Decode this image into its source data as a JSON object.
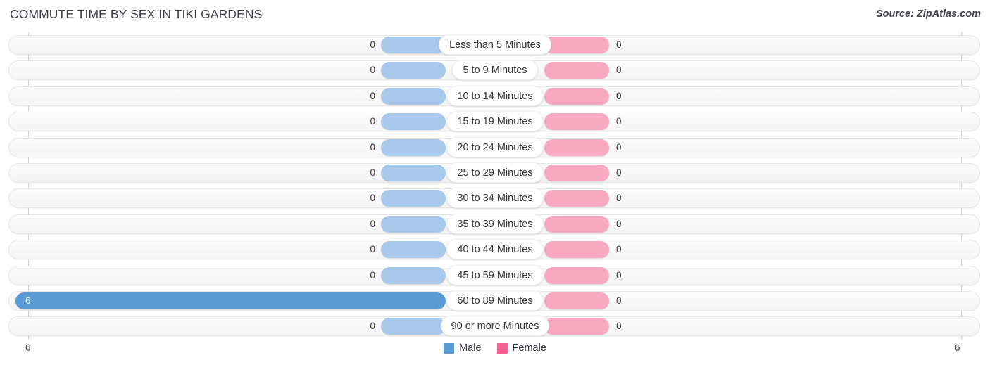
{
  "header": {
    "title": "COMMUTE TIME BY SEX IN TIKI GARDENS",
    "source": "Source: ZipAtlas.com"
  },
  "axis": {
    "left_label": "6",
    "right_label": "6"
  },
  "legend": {
    "items": [
      {
        "label": "Male",
        "color": "#5b9bd5",
        "icon": "square-swatch-icon"
      },
      {
        "label": "Female",
        "color": "#f2608f",
        "icon": "square-swatch-icon"
      }
    ]
  },
  "colors": {
    "male_bar": "#a8c8ec",
    "male_bar_highlight": "#5b9bd5",
    "female_bar": "#f9a8c2",
    "track": "#f6f6f6",
    "title_text": "#3b3b44"
  },
  "chart_data": {
    "type": "bar",
    "title": "COMMUTE TIME BY SEX IN TIKI GARDENS",
    "subtitle": "",
    "xlabel": "",
    "ylabel": "",
    "orientation": "horizontal",
    "style": "diverging-bidirectional",
    "grid": true,
    "legend_position": "bottom-center",
    "xlim": [
      6,
      6
    ],
    "axis_min_left": 6,
    "axis_min_right": 6,
    "categories": [
      "Less than 5 Minutes",
      "5 to 9 Minutes",
      "10 to 14 Minutes",
      "15 to 19 Minutes",
      "20 to 24 Minutes",
      "25 to 29 Minutes",
      "30 to 34 Minutes",
      "35 to 39 Minutes",
      "40 to 44 Minutes",
      "45 to 59 Minutes",
      "60 to 89 Minutes",
      "90 or more Minutes"
    ],
    "series": [
      {
        "name": "Male",
        "color": "#5b9bd5",
        "side": "left",
        "values": [
          0,
          0,
          0,
          0,
          0,
          0,
          0,
          0,
          0,
          0,
          6,
          0
        ]
      },
      {
        "name": "Female",
        "color": "#f2608f",
        "side": "right",
        "values": [
          0,
          0,
          0,
          0,
          0,
          0,
          0,
          0,
          0,
          0,
          0,
          0
        ]
      }
    ]
  },
  "rows": [
    {
      "label": "Less than 5 Minutes",
      "male": "0",
      "female": "0",
      "male_pct": 0,
      "female_pct": 0,
      "male_inside": false
    },
    {
      "label": "5 to 9 Minutes",
      "male": "0",
      "female": "0",
      "male_pct": 0,
      "female_pct": 0,
      "male_inside": false
    },
    {
      "label": "10 to 14 Minutes",
      "male": "0",
      "female": "0",
      "male_pct": 0,
      "female_pct": 0,
      "male_inside": false
    },
    {
      "label": "15 to 19 Minutes",
      "male": "0",
      "female": "0",
      "male_pct": 0,
      "female_pct": 0,
      "male_inside": false
    },
    {
      "label": "20 to 24 Minutes",
      "male": "0",
      "female": "0",
      "male_pct": 0,
      "female_pct": 0,
      "male_inside": false
    },
    {
      "label": "25 to 29 Minutes",
      "male": "0",
      "female": "0",
      "male_pct": 0,
      "female_pct": 0,
      "male_inside": false
    },
    {
      "label": "30 to 34 Minutes",
      "male": "0",
      "female": "0",
      "male_pct": 0,
      "female_pct": 0,
      "male_inside": false
    },
    {
      "label": "35 to 39 Minutes",
      "male": "0",
      "female": "0",
      "male_pct": 0,
      "female_pct": 0,
      "male_inside": false
    },
    {
      "label": "40 to 44 Minutes",
      "male": "0",
      "female": "0",
      "male_pct": 0,
      "female_pct": 0,
      "male_inside": false
    },
    {
      "label": "45 to 59 Minutes",
      "male": "0",
      "female": "0",
      "male_pct": 0,
      "female_pct": 0,
      "male_inside": false
    },
    {
      "label": "60 to 89 Minutes",
      "male": "6",
      "female": "0",
      "male_pct": 100,
      "female_pct": 0,
      "male_inside": true
    },
    {
      "label": "90 or more Minutes",
      "male": "0",
      "female": "0",
      "male_pct": 0,
      "female_pct": 0,
      "male_inside": false
    }
  ]
}
